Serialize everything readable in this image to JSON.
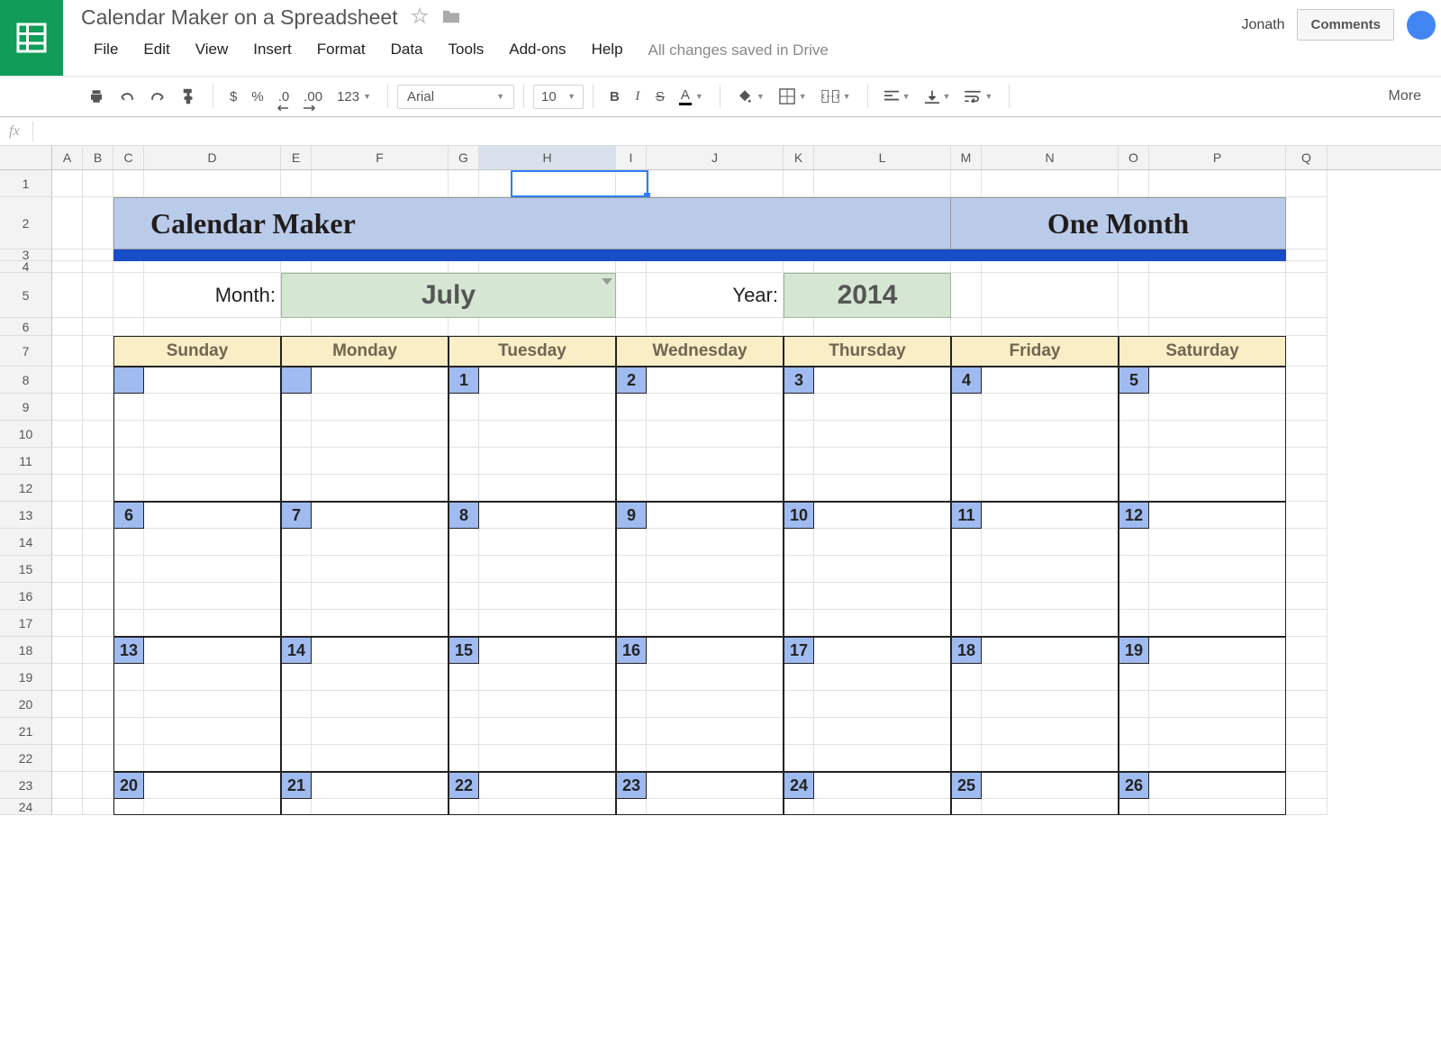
{
  "header": {
    "doc_title": "Calendar Maker on a Spreadsheet",
    "user_name": "Jonath",
    "comments_btn": "Comments"
  },
  "menu": {
    "file": "File",
    "edit": "Edit",
    "view": "View",
    "insert": "Insert",
    "format": "Format",
    "data": "Data",
    "tools": "Tools",
    "addons": "Add-ons",
    "help": "Help",
    "save_status": "All changes saved in Drive"
  },
  "toolbar": {
    "dollar": "$",
    "percent": "%",
    "dec_dec": ".0",
    "dec_inc": ".00",
    "num_fmt": "123",
    "font": "Arial",
    "size": "10",
    "bold": "B",
    "italic": "I",
    "strike": "S",
    "text_color": "A",
    "more": "More"
  },
  "formula_bar": {
    "fx": "fx"
  },
  "columns": [
    "A",
    "B",
    "C",
    "D",
    "E",
    "F",
    "G",
    "H",
    "I",
    "J",
    "K",
    "L",
    "M",
    "N",
    "O",
    "P",
    "Q"
  ],
  "selected_column": "H",
  "row_labels": [
    "1",
    "2",
    "3",
    "4",
    "5",
    "6",
    "7",
    "8",
    "9",
    "10",
    "11",
    "12",
    "13",
    "14",
    "15",
    "16",
    "17",
    "18",
    "19",
    "20",
    "21",
    "22",
    "23",
    "24"
  ],
  "calendar": {
    "title_left": "Calendar Maker",
    "title_right": "One Month",
    "month_label": "Month:",
    "month_value": "July",
    "year_label": "Year:",
    "year_value": "2014",
    "days": [
      "Sunday",
      "Monday",
      "Tuesday",
      "Wednesday",
      "Thursday",
      "Friday",
      "Saturday"
    ],
    "weeks": [
      [
        "",
        "",
        "1",
        "2",
        "3",
        "4",
        "5"
      ],
      [
        "6",
        "7",
        "8",
        "9",
        "10",
        "11",
        "12"
      ],
      [
        "13",
        "14",
        "15",
        "16",
        "17",
        "18",
        "19"
      ],
      [
        "20",
        "21",
        "22",
        "23",
        "24",
        "25",
        "26"
      ]
    ]
  }
}
